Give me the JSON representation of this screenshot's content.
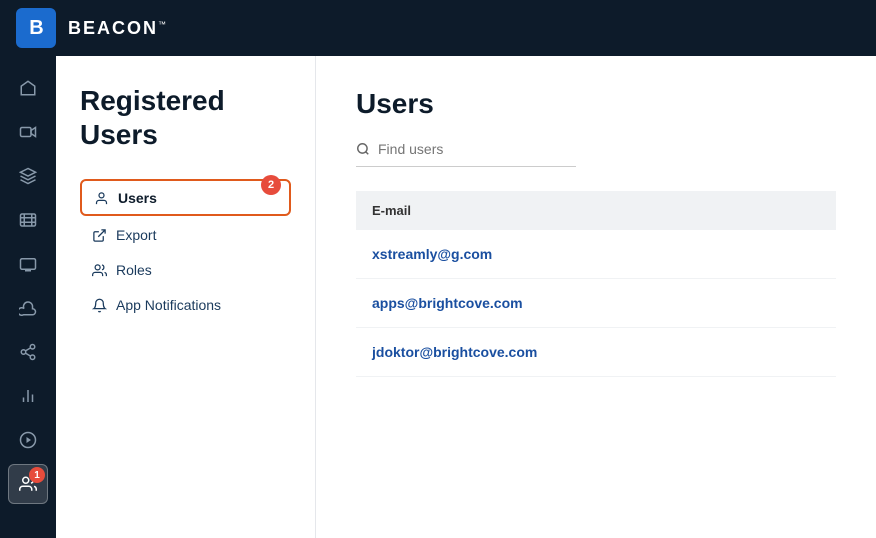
{
  "topbar": {
    "logo_letter": "B",
    "brand_name": "BEACON",
    "brand_tm": "™"
  },
  "icon_nav": {
    "items": [
      {
        "name": "home",
        "symbol": "⌂",
        "active": false
      },
      {
        "name": "video",
        "symbol": "▶",
        "active": false
      },
      {
        "name": "layers",
        "symbol": "⊞",
        "active": false
      },
      {
        "name": "film",
        "symbol": "▤",
        "active": false
      },
      {
        "name": "tv",
        "symbol": "▣",
        "active": false
      },
      {
        "name": "cloud",
        "symbol": "☁",
        "active": false
      },
      {
        "name": "share",
        "symbol": "⤢",
        "active": false
      },
      {
        "name": "analytics",
        "symbol": "▐",
        "active": false
      },
      {
        "name": "play-circle",
        "symbol": "⊙",
        "active": false
      },
      {
        "name": "registered-users",
        "symbol": "👥",
        "active": true,
        "badge": "1"
      }
    ]
  },
  "sidebar": {
    "title": "Registered\nUsers",
    "nav_items": [
      {
        "id": "users",
        "label": "Users",
        "icon": "user",
        "active": true,
        "badge": "2"
      },
      {
        "id": "export",
        "label": "Export",
        "icon": "export",
        "active": false
      },
      {
        "id": "roles",
        "label": "Roles",
        "icon": "roles",
        "active": false
      },
      {
        "id": "app-notifications",
        "label": "App Notifications",
        "icon": "bell",
        "active": false
      }
    ]
  },
  "main": {
    "title": "Users",
    "search_placeholder": "Find users",
    "table": {
      "columns": [
        "E-mail"
      ],
      "rows": [
        {
          "email": "xstreamly@g.com"
        },
        {
          "email": "apps@brightcove.com"
        },
        {
          "email": "jdoktor@brightcove.com"
        }
      ]
    }
  }
}
